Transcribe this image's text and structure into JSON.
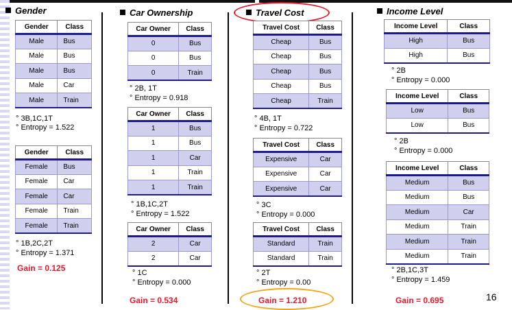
{
  "colors": {
    "gain": "#e8192c",
    "header_rule": "#1a1a8c",
    "row_fill": "#d0d0ee",
    "highlight_red": "#e8192c",
    "highlight_orange": "#f0a818"
  },
  "gender": {
    "heading": "Gender",
    "male_table": {
      "headers": [
        "Gender",
        "Class"
      ],
      "rows": [
        [
          "Male",
          "Bus"
        ],
        [
          "Male",
          "Bus"
        ],
        [
          "Male",
          "Bus"
        ],
        [
          "Male",
          "Car"
        ],
        [
          "Male",
          "Train"
        ]
      ]
    },
    "male_counts": "° 3B,1C,1T",
    "male_entropy": "° Entropy = 1.522",
    "female_table": {
      "headers": [
        "Gender",
        "Class"
      ],
      "rows": [
        [
          "Female",
          "Bus"
        ],
        [
          "Female",
          "Car"
        ],
        [
          "Female",
          "Car"
        ],
        [
          "Female",
          "Train"
        ],
        [
          "Female",
          "Train"
        ]
      ]
    },
    "female_counts": "° 1B,2C,2T",
    "female_entropy": "° Entropy = 1.371",
    "gain": "Gain = 0.125"
  },
  "car_ownership": {
    "heading": "Car Ownership",
    "t0": {
      "headers": [
        "Car Owner",
        "Class"
      ],
      "rows": [
        [
          "0",
          "Bus"
        ],
        [
          "0",
          "Bus"
        ],
        [
          "0",
          "Train"
        ]
      ]
    },
    "t0_counts": "° 2B, 1T",
    "t0_entropy": "° Entropy = 0.918",
    "t1": {
      "headers": [
        "Car Owner",
        "Class"
      ],
      "rows": [
        [
          "1",
          "Bus"
        ],
        [
          "1",
          "Bus"
        ],
        [
          "1",
          "Car"
        ],
        [
          "1",
          "Train"
        ],
        [
          "1",
          "Train"
        ]
      ]
    },
    "t1_counts": "° 1B,1C,2T",
    "t1_entropy": "° Entropy = 1.522",
    "t2": {
      "headers": [
        "Car Owner",
        "Class"
      ],
      "rows": [
        [
          "2",
          "Car"
        ],
        [
          "2",
          "Car"
        ]
      ]
    },
    "t2_counts": "° 1C",
    "t2_entropy": "° Entropy = 0.000",
    "gain": "Gain = 0.534"
  },
  "travel_cost": {
    "heading": "Travel Cost",
    "cheap": {
      "headers": [
        "Travel Cost",
        "Class"
      ],
      "rows": [
        [
          "Cheap",
          "Bus"
        ],
        [
          "Cheap",
          "Bus"
        ],
        [
          "Cheap",
          "Bus"
        ],
        [
          "Cheap",
          "Bus"
        ],
        [
          "Cheap",
          "Train"
        ]
      ]
    },
    "cheap_counts": "° 4B, 1T",
    "cheap_entropy": "° Entropy = 0.722",
    "expensive": {
      "headers": [
        "Travel Cost",
        "Class"
      ],
      "rows": [
        [
          "Expensive",
          "Car"
        ],
        [
          "Expensive",
          "Car"
        ],
        [
          "Expensive",
          "Car"
        ]
      ]
    },
    "expensive_counts": "° 3C",
    "expensive_entropy": "° Entropy = 0.000",
    "standard": {
      "headers": [
        "Travel Cost",
        "Class"
      ],
      "rows": [
        [
          "Standard",
          "Train"
        ],
        [
          "Standard",
          "Train"
        ]
      ]
    },
    "standard_counts": "° 2T",
    "standard_entropy": "° Entropy = 0.00",
    "gain": "Gain = 1.210"
  },
  "income_level": {
    "heading": "Income Level",
    "high": {
      "headers": [
        "Income Level",
        "Class"
      ],
      "rows": [
        [
          "High",
          "Bus"
        ],
        [
          "High",
          "Bus"
        ]
      ]
    },
    "high_counts": "° 2B",
    "high_entropy": "° Entropy = 0.000",
    "low": {
      "headers": [
        "Income Level",
        "Class"
      ],
      "rows": [
        [
          "Low",
          "Bus"
        ],
        [
          "Low",
          "Bus"
        ]
      ]
    },
    "low_counts": "° 2B",
    "low_entropy": "° Entropy = 0.000",
    "medium": {
      "headers": [
        "Income Level",
        "Class"
      ],
      "rows": [
        [
          "Medium",
          "Bus"
        ],
        [
          "Medium",
          "Bus"
        ],
        [
          "Medium",
          "Car"
        ],
        [
          "Medium",
          "Train"
        ],
        [
          "Medium",
          "Train"
        ],
        [
          "Medium",
          "Train"
        ]
      ]
    },
    "medium_counts": "° 2B,1C,3T",
    "medium_entropy": "° Entropy = 1.459",
    "gain": "Gain = 0.695"
  },
  "page_number": "16"
}
